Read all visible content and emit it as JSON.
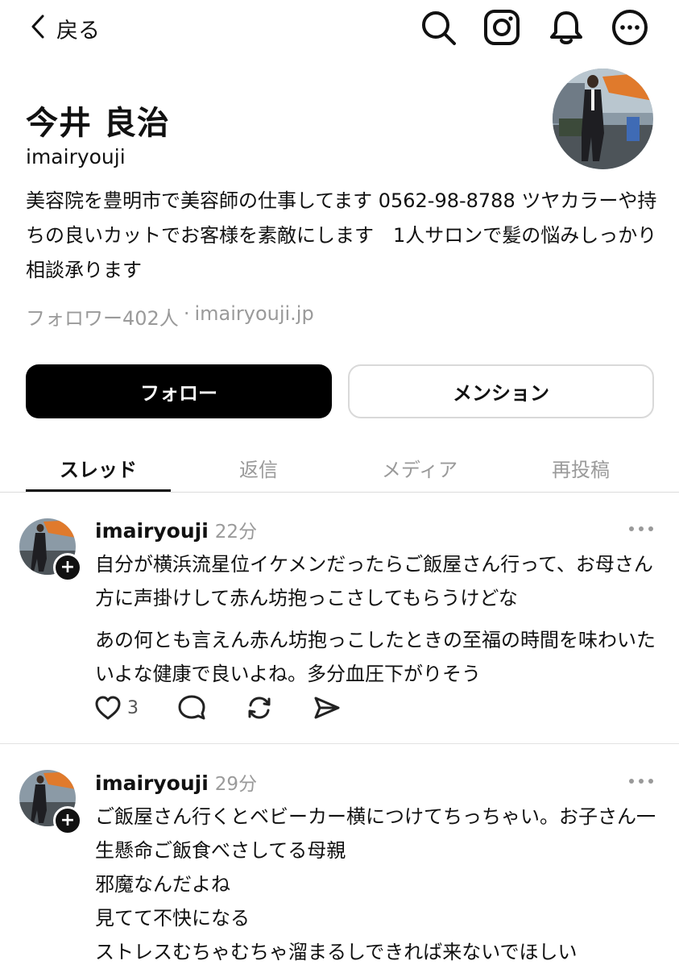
{
  "nav": {
    "back_label": "戻る",
    "icons": [
      "search-icon",
      "instagram-icon",
      "bell-icon",
      "more-icon"
    ]
  },
  "profile": {
    "name": "今井 良治",
    "handle": "imairyouji",
    "bio": "美容院を豊明市で美容師の仕事してます 0562-98-8788 ツヤカラーや持ちの良いカットでお客様を素敵にします　1人サロンで髪の悩みしっかり相談承ります",
    "followers": "フォロワー402人",
    "separator": "·",
    "website": "imairyouji.jp"
  },
  "buttons": {
    "follow": "フォロー",
    "mention": "メンション"
  },
  "tabs": [
    {
      "label": "スレッド",
      "active": true
    },
    {
      "label": "返信",
      "active": false
    },
    {
      "label": "メディア",
      "active": false
    },
    {
      "label": "再投稿",
      "active": false
    }
  ],
  "posts": [
    {
      "user": "imairyouji",
      "time": "22分",
      "lines": [
        "自分が横浜流星位イケメンだったらご飯屋さん行って、お母さん方に声掛けして赤ん坊抱っこさしてもらうけどな",
        "あの何とも言えん赤ん坊抱っこしたときの至福の時間を味わいたいよな健康で良いよね。多分血圧下がりそう"
      ],
      "like_count": "3"
    },
    {
      "user": "imairyouji",
      "time": "29分",
      "lines": [
        "ご飯屋さん行くとベビーカー横につけてちっちゃい。お子さん一生懸命ご飯食べさしてる母親",
        "邪魔なんだよね",
        "見てて不快になる",
        "ストレスむちゃむちゃ溜まるしできれば来ないでほしい"
      ]
    }
  ],
  "colors": {
    "primary": "#000000",
    "muted_text": "#9a9a9a",
    "divider": "#dcdcdc"
  }
}
